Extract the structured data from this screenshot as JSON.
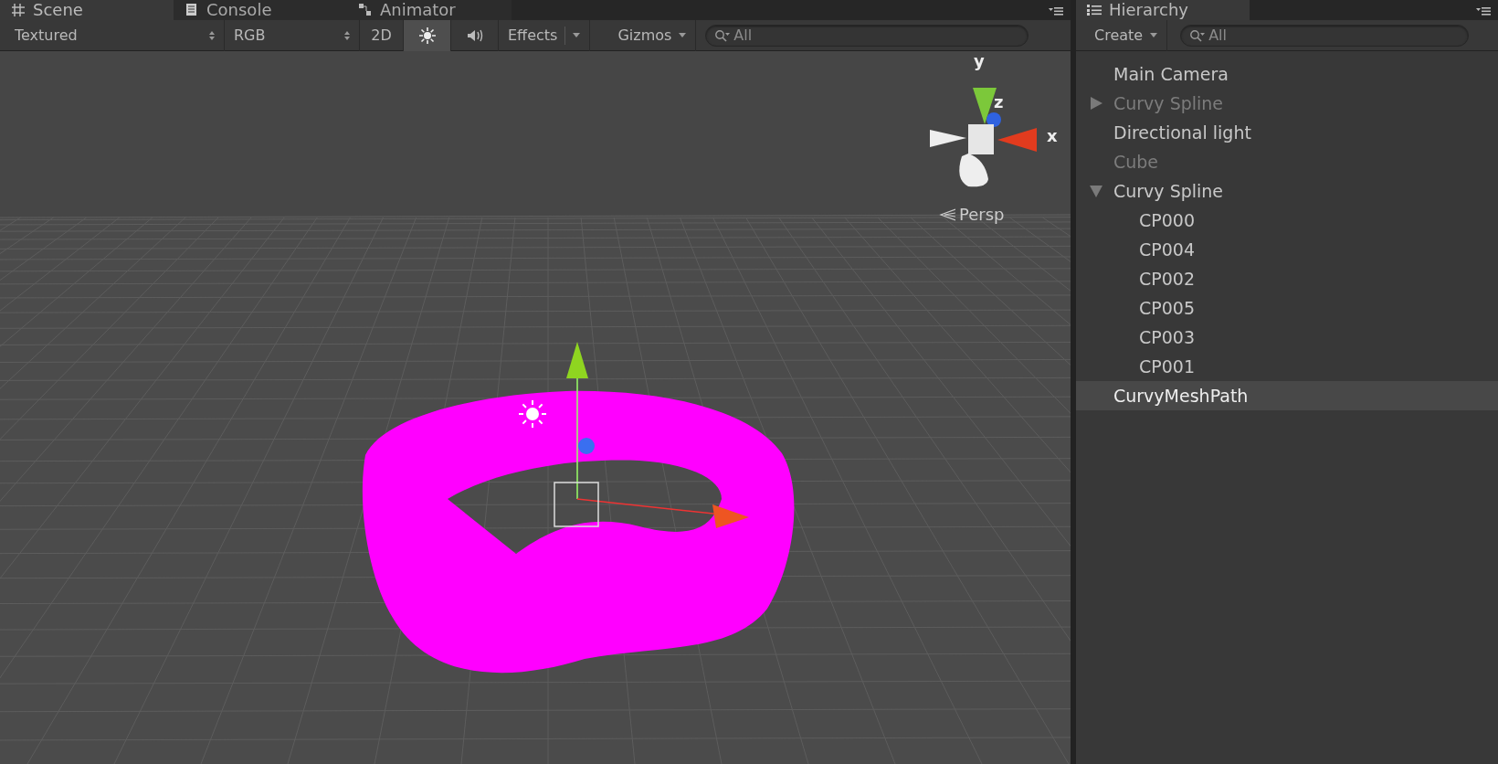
{
  "scene_panel": {
    "tabs": [
      {
        "label": "Scene",
        "selected": true
      },
      {
        "label": "Console",
        "selected": false
      },
      {
        "label": "Animator",
        "selected": false
      }
    ],
    "toolbar": {
      "draw_mode": "Textured",
      "render_mode": "RGB",
      "buttons": [
        {
          "kind": "text",
          "label": "2D",
          "on": false
        },
        {
          "kind": "lighting",
          "on": true
        },
        {
          "kind": "audio",
          "on": false
        }
      ],
      "effects": "Effects",
      "gizmos": "Gizmos",
      "search": {
        "placeholder": "All"
      }
    },
    "viewport": {
      "axes": [
        "y",
        "z",
        "x"
      ],
      "projection": "Persp"
    }
  },
  "hierarchy": {
    "tab": {
      "label": "Hierarchy"
    },
    "create": "Create",
    "search": {
      "placeholder": "All"
    },
    "items": [
      {
        "label": "Main Camera",
        "active": true,
        "selected": false
      },
      {
        "label": "Curvy Spline",
        "active": false,
        "selected": false,
        "expanded": false
      },
      {
        "label": "Directional light",
        "active": true,
        "selected": false
      },
      {
        "label": "Cube",
        "active": false,
        "selected": false
      },
      {
        "label": "Curvy Spline",
        "active": true,
        "selected": false,
        "expanded": true,
        "children": [
          {
            "label": "CP000",
            "active": true,
            "selected": false
          },
          {
            "label": "CP004",
            "active": true,
            "selected": false
          },
          {
            "label": "CP002",
            "active": true,
            "selected": false
          },
          {
            "label": "CP005",
            "active": true,
            "selected": false
          },
          {
            "label": "CP003",
            "active": true,
            "selected": false
          },
          {
            "label": "CP001",
            "active": true,
            "selected": false
          }
        ]
      },
      {
        "label": "CurvyMeshPath",
        "active": true,
        "selected": true
      }
    ]
  }
}
